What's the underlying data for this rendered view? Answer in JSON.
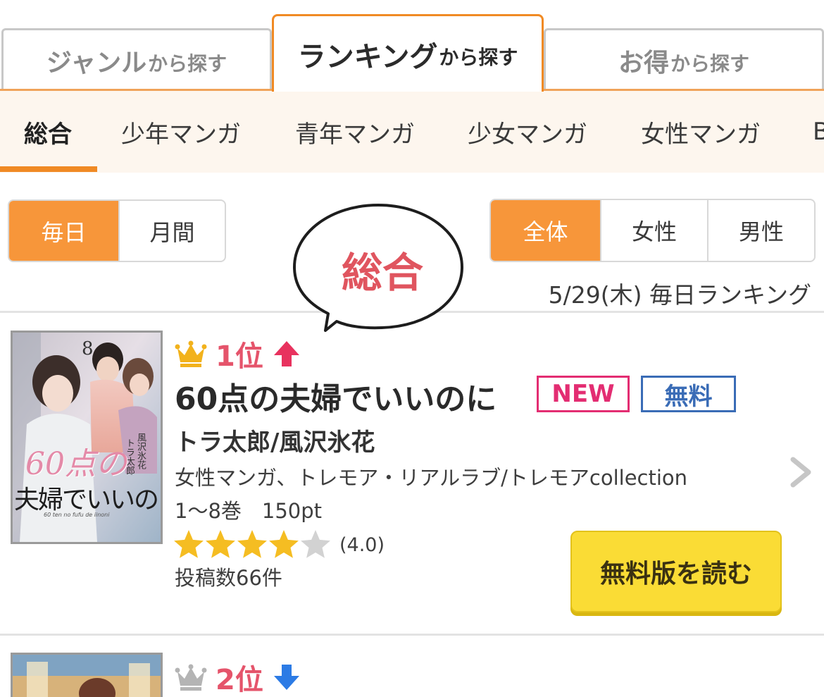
{
  "tabs": [
    {
      "label_main": "ジャンル",
      "label_sub": "から探す",
      "active": false
    },
    {
      "label_main": "ランキング",
      "label_sub": "から探す",
      "active": true
    },
    {
      "label_main": "お得",
      "label_sub": "から探す",
      "active": false
    }
  ],
  "genre_nav": [
    "総合",
    "少年マンガ",
    "青年マンガ",
    "少女マンガ",
    "女性マンガ",
    "B"
  ],
  "period_toggle": {
    "options": [
      "毎日",
      "月間"
    ],
    "selected": "毎日"
  },
  "audience_toggle": {
    "options": [
      "全体",
      "女性",
      "男性"
    ],
    "selected": "全体"
  },
  "bubble_text": "総合",
  "date_label": "5/29(木) 毎日ランキング",
  "entries": [
    {
      "rank": "1位",
      "trend": "up",
      "title": "60点の夫婦でいいのに",
      "badges": [
        "NEW",
        "無料"
      ],
      "author": "トラ太郎/風沢氷花",
      "genre": "女性マンガ、トレモア・リアルラブ/トレモアcollection",
      "volumes": "1〜8巻　150pt",
      "rating_value": 4.0,
      "rating_text": "(4.0)",
      "posts": "投稿数66件",
      "button_label": "無料版を読む",
      "cover": {
        "volume": "8",
        "title_line1": "60点の",
        "title_line2": "夫婦でいいのに",
        "romaji": "60 ten no fufu de iinoni",
        "authors": [
          "風沢氷花",
          "トラ太郎"
        ]
      }
    },
    {
      "rank": "2位",
      "trend": "down"
    }
  ],
  "colors": {
    "accent": "#f08a24",
    "rank_red": "#e5546b",
    "new_pink": "#e32d72",
    "free_blue": "#3a6cb6",
    "button_yellow": "#fadc35",
    "up_arrow": "#e8325e",
    "down_arrow": "#2c7be5",
    "crown_gold": "#f2b21c",
    "crown_gray": "#b4b4b4"
  },
  "icons": {
    "rank1": "crown-gold-icon",
    "rank2": "crown-silver-icon",
    "up": "arrow-up-icon",
    "down": "arrow-down-icon",
    "detail": "chevron-right-icon"
  }
}
